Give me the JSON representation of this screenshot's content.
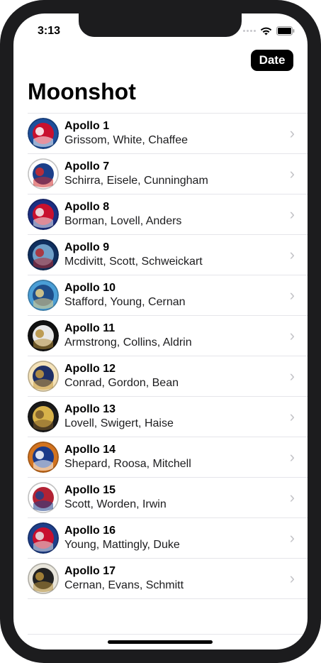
{
  "status_bar": {
    "time": "3:13"
  },
  "nav": {
    "sort_button_label": "Date",
    "title": "Moonshot"
  },
  "missions": [
    {
      "title": "Apollo 1",
      "crew": "Grissom, White, Chaffee",
      "badge_colors": [
        "#1e4f9c",
        "#c8102e",
        "#ffffff"
      ]
    },
    {
      "title": "Apollo 7",
      "crew": "Schirra, Eisele, Cunningham",
      "badge_colors": [
        "#ffffff",
        "#1c3f8a",
        "#d22c2c"
      ]
    },
    {
      "title": "Apollo 8",
      "crew": "Borman, Lovell, Anders",
      "badge_colors": [
        "#1c2f83",
        "#c8102e",
        "#f2f2f2"
      ]
    },
    {
      "title": "Apollo 9",
      "crew": "Mcdivitt, Scott, Schweickart",
      "badge_colors": [
        "#0f2f5f",
        "#6fa0c8",
        "#b3282d"
      ]
    },
    {
      "title": "Apollo 10",
      "crew": "Stafford, Young, Cernan",
      "badge_colors": [
        "#4a9ed6",
        "#1f4e8a",
        "#e9d48a"
      ]
    },
    {
      "title": "Apollo 11",
      "crew": "Armstrong, Collins, Aldrin",
      "badge_colors": [
        "#111111",
        "#e8e8e8",
        "#b58e3a"
      ]
    },
    {
      "title": "Apollo 12",
      "crew": "Conrad, Gordon, Bean",
      "badge_colors": [
        "#f4e2b8",
        "#1e2f66",
        "#c79a3f"
      ]
    },
    {
      "title": "Apollo 13",
      "crew": "Lovell, Swigert, Haise",
      "badge_colors": [
        "#1a1a1a",
        "#d8b24a",
        "#7a5a2a"
      ]
    },
    {
      "title": "Apollo 14",
      "crew": "Shepard, Roosa, Mitchell",
      "badge_colors": [
        "#d2731f",
        "#1a3a8a",
        "#ffffff"
      ]
    },
    {
      "title": "Apollo 15",
      "crew": "Scott, Worden, Irwin",
      "badge_colors": [
        "#ffffff",
        "#b22234",
        "#1e3f8a"
      ]
    },
    {
      "title": "Apollo 16",
      "crew": "Young, Mattingly, Duke",
      "badge_colors": [
        "#1e3f8a",
        "#c8102e",
        "#e9e9e9"
      ]
    },
    {
      "title": "Apollo 17",
      "crew": "Cernan, Evans, Schmitt",
      "badge_colors": [
        "#e9e6dc",
        "#222222",
        "#b58e3a"
      ]
    }
  ],
  "icons": {
    "row_chevron": "chevron-right-icon",
    "wifi": "wifi-icon",
    "battery": "battery-icon"
  }
}
